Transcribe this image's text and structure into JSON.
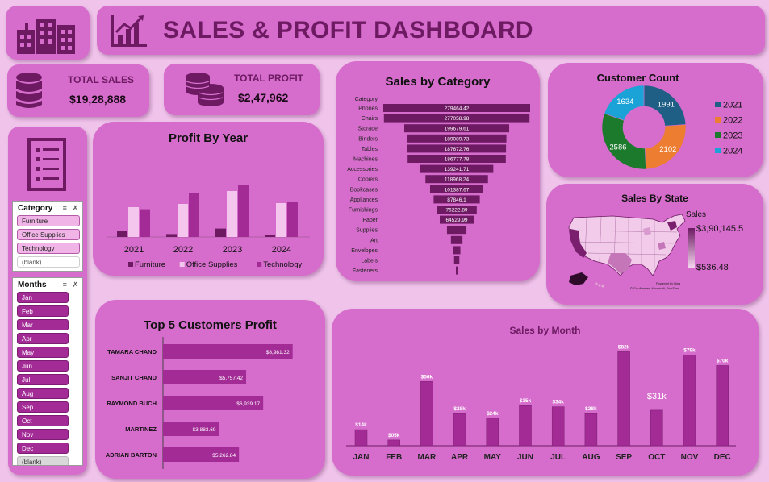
{
  "header": {
    "title": "SALES & PROFIT DASHBOARD"
  },
  "kpis": {
    "total_sales_label": "TOTAL SALES",
    "total_sales_value": "$19,28,888",
    "total_profit_label": "TOTAL PROFIT",
    "total_profit_value": "$2,47,962"
  },
  "colors": {
    "card": "#d66dcc",
    "background": "#efc3ea",
    "accent_dark": "#6d1a63",
    "furniture": "#6d1a63",
    "office_supplies": "#f4c6ee",
    "technology": "#a32b96",
    "donut_2021": "#1f5f86",
    "donut_2022": "#ed7d31",
    "donut_2023": "#1b7a2c",
    "donut_2024": "#1ba3d8"
  },
  "slicers": {
    "category": {
      "title": "Category",
      "items": [
        "Furniture",
        "Office Supplies",
        "Technology",
        "(blank)"
      ]
    },
    "months": {
      "title": "Months",
      "items": [
        "Jan",
        "Feb",
        "Mar",
        "Apr",
        "May",
        "Jun",
        "Jul",
        "Aug",
        "Sep",
        "Oct",
        "Nov",
        "Dec",
        "(blank)"
      ]
    }
  },
  "chart_data": [
    {
      "id": "profit_by_year",
      "type": "bar",
      "title": "Profit By Year",
      "categories": [
        "2021",
        "2022",
        "2023",
        "2024"
      ],
      "series": [
        {
          "name": "Furniture",
          "values": [
            3500,
            1800,
            5200,
            1200
          ]
        },
        {
          "name": "Office Supplies",
          "values": [
            18500,
            20500,
            28500,
            21000
          ]
        },
        {
          "name": "Technology",
          "values": [
            17200,
            27500,
            32500,
            22000
          ]
        }
      ],
      "ylim": [
        0,
        40000
      ],
      "legend": "bottom"
    },
    {
      "id": "sales_by_category",
      "type": "bar",
      "orientation": "horizontal",
      "title": "Sales by Category",
      "axis_label": "Category",
      "categories": [
        "Phones",
        "Chairs",
        "Storage",
        "Binders",
        "Tables",
        "Machines",
        "Accessories",
        "Copiers",
        "Bookcases",
        "Appliances",
        "Furnishings",
        "Paper",
        "Supplies",
        "Art",
        "Envelopes",
        "Labels",
        "Fasteners"
      ],
      "values": [
        279464.42,
        277058.98,
        199679.61,
        189089.73,
        187672.76,
        186777.78,
        139241.71,
        118968.24,
        101387.67,
        87846.1,
        76222.89,
        64529.99,
        37000,
        22000,
        14000,
        10000,
        2500
      ],
      "labels": [
        "279464.42",
        "277058.98",
        "199679.61",
        "189089.73",
        "187672.76",
        "186777.78",
        "139241.71",
        "118968.24",
        "101387.67",
        "87846.1",
        "76222.89",
        "64529.99",
        "",
        "",
        "",
        "",
        ""
      ]
    },
    {
      "id": "customer_count",
      "type": "pie",
      "style": "donut",
      "title": "Customer  Count",
      "categories": [
        "2021",
        "2022",
        "2023",
        "2024"
      ],
      "values": [
        1991,
        2102,
        2586,
        1634
      ],
      "legend": "right"
    },
    {
      "id": "sales_by_state",
      "type": "map",
      "title": "Sales By State",
      "legend_title": "Sales",
      "legend_max": "$3,90,145.5",
      "legend_min": "$536.48",
      "credit_1": "Powered by Bing",
      "credit_2": "© GeoNames, Microsoft, TomTom"
    },
    {
      "id": "top5_customers_profit",
      "type": "bar",
      "orientation": "horizontal",
      "title": "Top 5 Customers Profit",
      "categories": [
        "TAMARA CHAND",
        "SANJIT CHAND",
        "RAYMOND BUCH",
        "MARTINEZ",
        "ADRIAN BARTON"
      ],
      "values": [
        8981.32,
        5757.42,
        6939.17,
        3883.69,
        5262.84
      ],
      "labels": [
        "$8,981.32",
        "$5,757.42",
        "$6,939.17",
        "$3,883.69",
        "$5,262.84"
      ],
      "xlim": [
        0,
        9500
      ]
    },
    {
      "id": "sales_by_month",
      "type": "bar",
      "title": "Sales by Month",
      "categories": [
        "JAN",
        "FEB",
        "MAR",
        "APR",
        "MAY",
        "JUN",
        "JUL",
        "AUG",
        "SEP",
        "OCT",
        "NOV",
        "DEC"
      ],
      "values": [
        14000,
        5000,
        56000,
        28000,
        24000,
        35000,
        34000,
        28000,
        82000,
        31000,
        79000,
        70000
      ],
      "labels": [
        "$14k",
        "$05k",
        "$56k",
        "$28k",
        "$24k",
        "$35k",
        "$34k",
        "$28k",
        "$82k",
        "$31k",
        "$79k",
        "$70k"
      ],
      "ylim": [
        0,
        90000
      ]
    }
  ]
}
